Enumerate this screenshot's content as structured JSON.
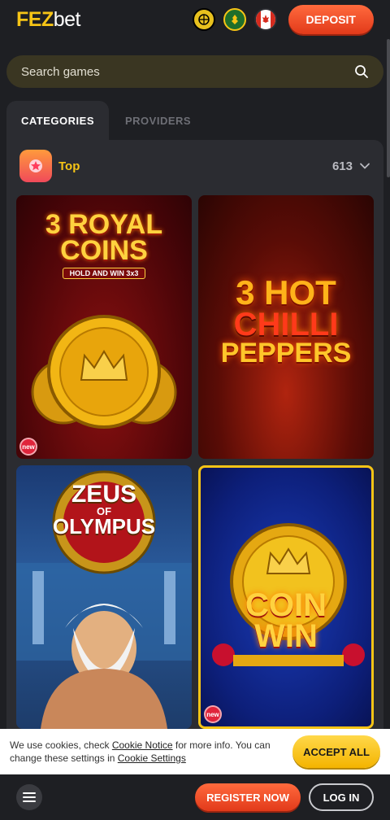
{
  "header": {
    "logo_main": "FEZ",
    "logo_suffix": "bet",
    "deposit_label": "DEPOSIT",
    "icons": [
      "basketball-icon",
      "wheat-icon",
      "canada-flag-icon"
    ]
  },
  "search": {
    "placeholder": "Search games"
  },
  "tabs": [
    {
      "label": "CATEGORIES",
      "active": true
    },
    {
      "label": "PROVIDERS",
      "active": false
    }
  ],
  "category": {
    "label": "Top",
    "count": "613",
    "icon": "star-icon"
  },
  "games": [
    {
      "title_line1": "3 ROYAL",
      "title_line2": "COINS",
      "subtitle": "HOLD AND WIN 3x3",
      "badge": "new"
    },
    {
      "title_line1": "3 HOT",
      "title_line2": "CHILLI",
      "title_line3": "PEPPERS",
      "badge": ""
    },
    {
      "title_line1": "ZEUS",
      "title_line2": "OF",
      "title_line3": "OLYMPUS",
      "badge": ""
    },
    {
      "title_line1": "COIN",
      "title_line2": "WIN",
      "badge": "new"
    }
  ],
  "cookie": {
    "text_before": "We use cookies, check ",
    "link1": "Cookie Notice",
    "text_middle": " for more info. You can change these settings in ",
    "link2": "Cookie Settings",
    "accept_label": "ACCEPT ALL"
  },
  "bottom": {
    "register_label": "REGISTER NOW",
    "login_label": "LOG IN"
  },
  "colors": {
    "brand_yellow": "#f6c416",
    "cta_red": "#e23a1a",
    "bg": "#1e1f23",
    "panel": "#2b2c31"
  }
}
